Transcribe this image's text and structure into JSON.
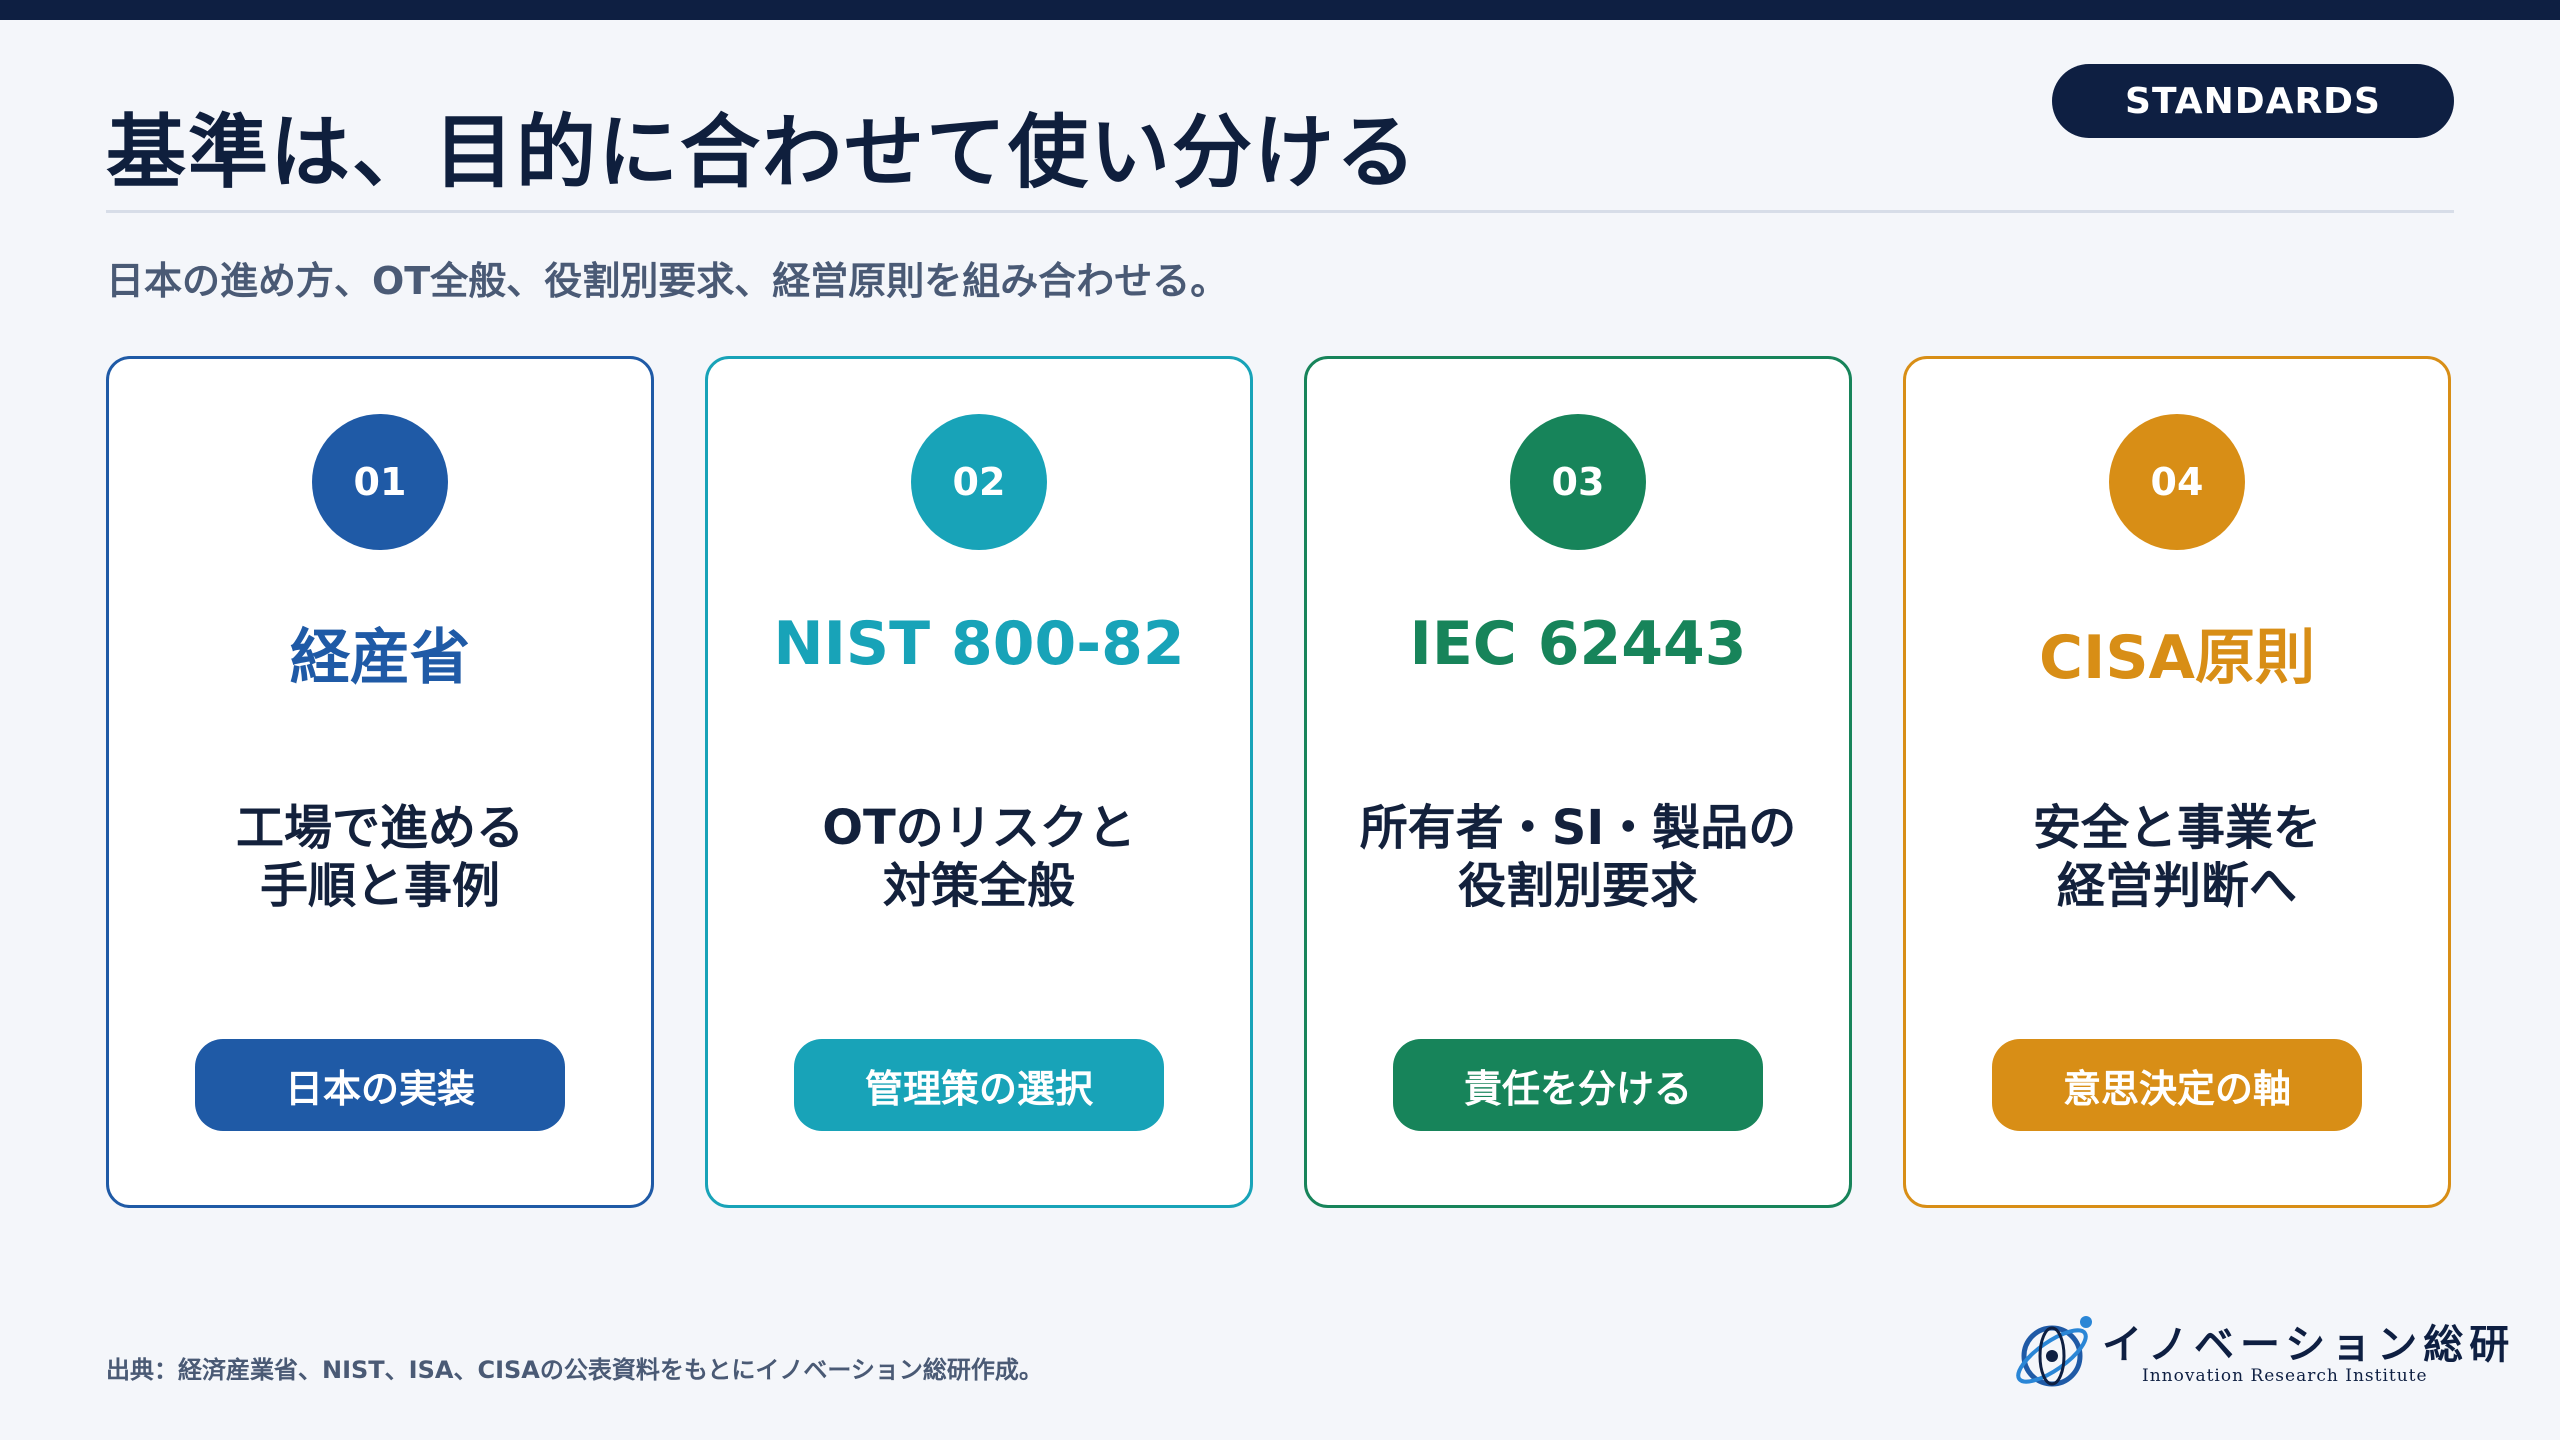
{
  "header": {
    "title": "基準は、目的に合わせて使い分ける",
    "badge": "STANDARDS",
    "subtitle": "日本の進め方、OT全般、役割別要求、経営原則を組み合わせる。"
  },
  "cards": [
    {
      "number": "01",
      "name": "経産省",
      "desc_line1": "工場で進める",
      "desc_line2": "手順と事例",
      "tag": "日本の実装",
      "color": "#1f5aa6"
    },
    {
      "number": "02",
      "name": "NIST 800-82",
      "desc_line1": "OTのリスクと",
      "desc_line2": "対策全般",
      "tag": "管理策の選択",
      "color": "#18a3b8"
    },
    {
      "number": "03",
      "name": "IEC 62443",
      "desc_line1": "所有者・SI・製品の",
      "desc_line2": "役割別要求",
      "tag": "責任を分ける",
      "color": "#17845a"
    },
    {
      "number": "04",
      "name": "CISA原則",
      "desc_line1": "安全と事業を",
      "desc_line2": "経営判断へ",
      "tag": "意思決定の軸",
      "color": "#d88e16"
    }
  ],
  "footer": {
    "source": "出典：経済産業省、NIST、ISA、CISAの公表資料をもとにイノベーション総研作成。"
  },
  "logo": {
    "name": "イノベーション総研",
    "subname": "Innovation Research Institute",
    "icon": "atom-globe-icon"
  }
}
